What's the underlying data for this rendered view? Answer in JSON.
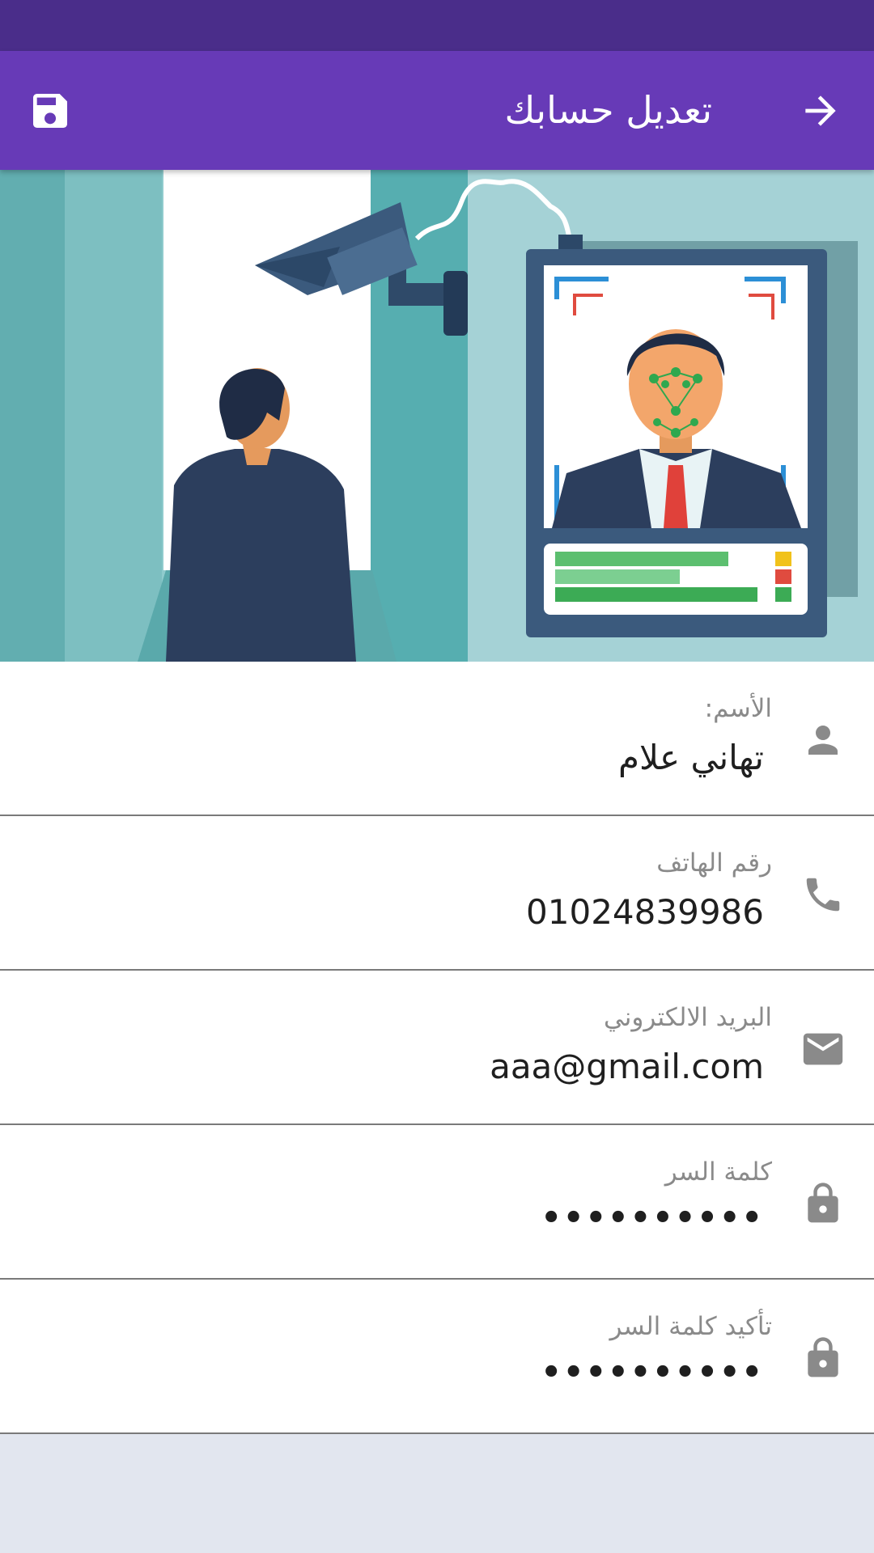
{
  "app_bar": {
    "title": "تعديل حسابك",
    "back_icon": "arrow-forward-icon",
    "save_icon": "save-icon",
    "background": "#673ab7"
  },
  "status_bar": {
    "background": "#4a2d8a"
  },
  "fields": {
    "name": {
      "label": "الأسم:",
      "value": "تهاني علام",
      "icon": "person-icon"
    },
    "phone": {
      "label": "رقم الهاتف",
      "value": "01024839986",
      "icon": "phone-icon"
    },
    "email": {
      "label": "البريد الالكتروني",
      "value": "aaa@gmail.com",
      "icon": "email-icon"
    },
    "password": {
      "label": "كلمة السر",
      "value": "••••••••••",
      "icon": "lock-icon"
    },
    "confirm_password": {
      "label": "تأكيد كلمة السر",
      "value": "••••••••••",
      "icon": "lock-icon"
    }
  },
  "colors": {
    "icon_gray": "#8a8a8a",
    "divider": "#7a7a7a",
    "page_bg": "#e2e6ef"
  }
}
